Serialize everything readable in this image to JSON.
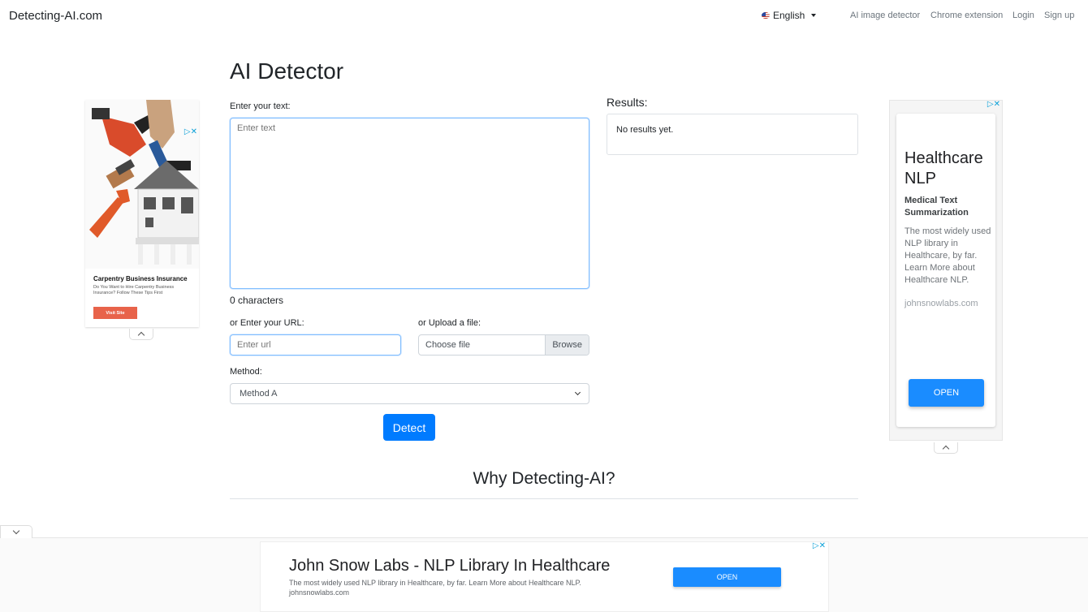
{
  "navbar": {
    "brand": "Detecting-AI.com",
    "language": "English",
    "links": [
      "AI image detector",
      "Chrome extension",
      "Login",
      "Sign up"
    ]
  },
  "main": {
    "title": "AI Detector",
    "text_label": "Enter your text:",
    "text_placeholder": "Enter text",
    "char_count": "0 characters",
    "url_label": "or Enter your URL:",
    "url_placeholder": "Enter url",
    "file_label": "or Upload a file:",
    "file_placeholder": "Choose file",
    "browse_label": "Browse",
    "method_label": "Method:",
    "method_selected": "Method A",
    "detect_label": "Detect"
  },
  "results": {
    "title": "Results:",
    "message": "No results yet."
  },
  "why": {
    "heading": "Why Detecting-AI?"
  },
  "left_ad": {
    "title": "Carpentry Business Insurance",
    "subtitle": "Do You Want to Hire Carpentry Business Insurance? Follow These Tips First",
    "button": "Visit Site"
  },
  "right_ad": {
    "headline": "Healthcare NLP",
    "subheadline": "Medical Text Summarization",
    "body": "The most widely used NLP library in Healthcare, by far. Learn More about Healthcare NLP.",
    "site": "johnsnowlabs.com",
    "button": "OPEN"
  },
  "bottom_ad": {
    "headline": "John Snow Labs - NLP Library In Healthcare",
    "body": "The most widely used NLP library in Healthcare, by far. Learn More about Healthcare NLP.",
    "site": "johnsnowlabs.com",
    "button": "OPEN"
  },
  "colors": {
    "primary": "#007bff",
    "ad_button": "#1a8cff",
    "visit_button": "#e8634a"
  }
}
